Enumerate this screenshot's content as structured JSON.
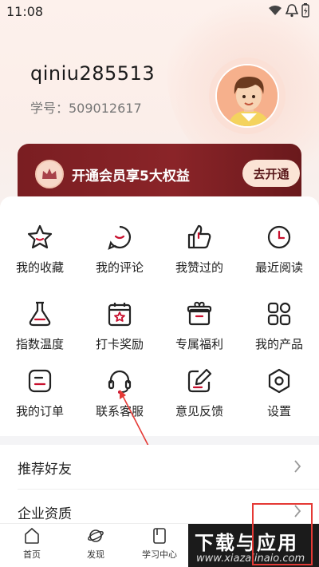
{
  "status": {
    "time": "11:08"
  },
  "profile": {
    "username": "qiniu285513",
    "student_id": "学号：509012617"
  },
  "vip": {
    "text": "开通会员享5大权益",
    "button": "去开通"
  },
  "grid": [
    {
      "label": "我的收藏",
      "icon": "star-icon"
    },
    {
      "label": "我的评论",
      "icon": "comment-icon"
    },
    {
      "label": "我赞过的",
      "icon": "thumbs-up-icon"
    },
    {
      "label": "最近阅读",
      "icon": "clock-icon"
    },
    {
      "label": "指数温度",
      "icon": "flask-icon"
    },
    {
      "label": "打卡奖励",
      "icon": "calendar-star-icon"
    },
    {
      "label": "专属福利",
      "icon": "gift-box-icon"
    },
    {
      "label": "我的产品",
      "icon": "apps-icon"
    },
    {
      "label": "我的订单",
      "icon": "order-icon"
    },
    {
      "label": "联系客服",
      "icon": "headset-icon"
    },
    {
      "label": "意见反馈",
      "icon": "feedback-edit-icon"
    },
    {
      "label": "设置",
      "icon": "settings-hex-icon"
    }
  ],
  "list": [
    {
      "label": "推荐好友"
    },
    {
      "label": "企业资质"
    }
  ],
  "tabs": [
    {
      "label": "首页",
      "icon": "home-icon"
    },
    {
      "label": "发现",
      "icon": "planet-icon"
    },
    {
      "label": "学习中心",
      "icon": "book-icon"
    }
  ],
  "watermark": {
    "title": "下载与应用",
    "url": "www.xiazaiinaio.com"
  },
  "colors": {
    "accent": "#8a2428",
    "annotation": "#e53935"
  }
}
